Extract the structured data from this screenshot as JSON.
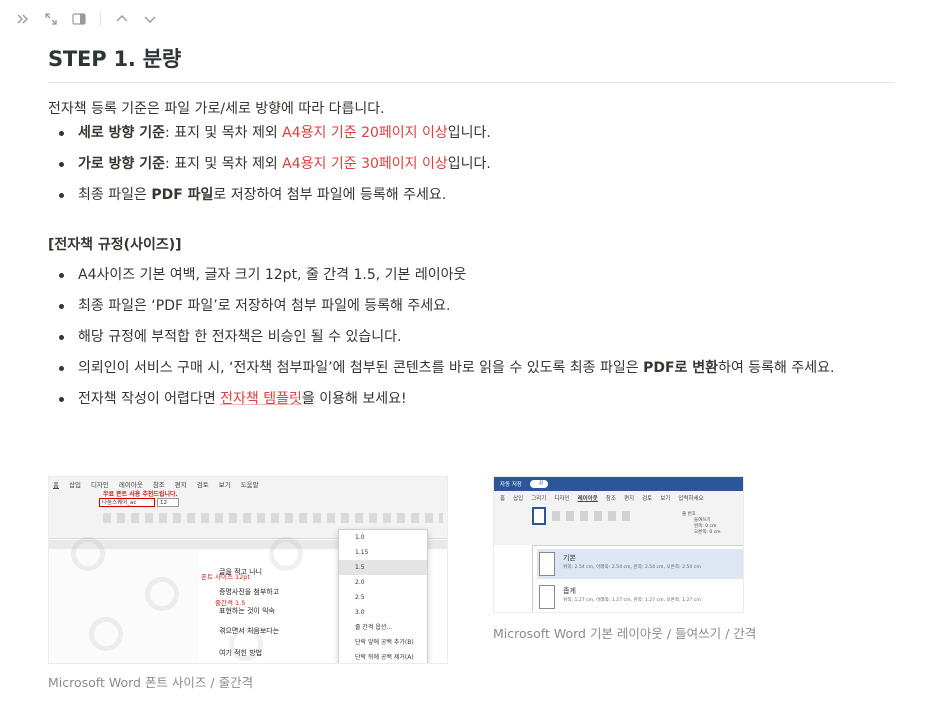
{
  "page": {
    "title": "STEP 1. 분량",
    "intro": "전자책 등록 기준은 파일 가로/세로 방향에 따라 다릅니다.",
    "bullets": [
      {
        "bold": "세로 방향 기준",
        "text": ": 표지 및 목차 제외 ",
        "red": "A4용지 기준 20페이지 이상",
        "tail": "입니다."
      },
      {
        "bold": "가로 방향 기준",
        "text": ": 표지 및 목차 제외 ",
        "red": "A4용지 기준 30페이지 이상",
        "tail": "입니다."
      },
      {
        "pre": "최종 파일은 ",
        "bold": "PDF 파일",
        "tail": "로 저장하여 첨부 파일에 등록해 주세요."
      }
    ],
    "section_heading": "[전자책 규정(사이즈)]",
    "rules": [
      {
        "text": "A4사이즈 기본 여백, 글자 크기 12pt, 줄 간격 1.5, 기본 레이아웃"
      },
      {
        "text": "최종 파일은 ‘PDF 파일’로 저장하여 첨부 파일에 등록해 주세요."
      },
      {
        "text": "해당 규정에 부적합 한 전자책은 비승인 될 수 있습니다."
      },
      {
        "pre": "의뢰인이 서비스 구매 시, ‘전자책 첨부파일’에 첨부된 콘텐츠를 바로 읽을 수 있도록 최종 파일은 ",
        "bold": "PDF로 변환",
        "tail": "하여 등록해 주세요."
      },
      {
        "pre": "전자책 작성이 어렵다면 ",
        "link": "전자책 템플릿",
        "hl": "을",
        "tail": " 이용해 보세요!"
      }
    ]
  },
  "toolbar": {
    "icons": [
      "double-chevron-right-icon",
      "expand-icon",
      "sidebar-panel-icon",
      "chevron-up-icon",
      "chevron-down-icon"
    ]
  },
  "figures": {
    "left_caption": "Microsoft Word 폰트 사이즈 / 줄간격",
    "right_caption": "Microsoft Word 기본 레이아웃 / 들여쓰기 / 간격",
    "word1": {
      "tabs": [
        "홈",
        "삽입",
        "디자인",
        "레이아웃",
        "참조",
        "편지",
        "검토",
        "보기",
        "도움말"
      ],
      "notice": "무료 폰트 사용 추천드립니다.",
      "font_name": "나눔스퀘어_ac",
      "font_size": "12",
      "tag_size": "폰트 사이즈 12pt",
      "tag_spacing": "줄간격 1.5",
      "line_spacing_options": [
        "1.0",
        "1.15",
        "1.5",
        "2.0",
        "2.5",
        "3.0",
        "줄 간격 옵션...",
        "단락 앞에 공백 추가(B)",
        "단락 뒤에 공백 제거(A)"
      ],
      "doc_lines": [
        "글을 적고 나니",
        "증명사진을 첨부하고",
        "표현하는 것이 익숙",
        "겪으면서 처음보다는",
        "여기 적힌 방법"
      ]
    },
    "word2": {
      "autosave": "자동 저장",
      "toggle": "끔",
      "tabs": [
        "홈",
        "삽입",
        "그리기",
        "디자인",
        "레이아웃",
        "참조",
        "편지",
        "검토",
        "보기",
        "입력하세요"
      ],
      "option1_name": "기본",
      "option1_desc": "위쪽: 2.54 cm, 아래쪽: 2.54 cm, 왼쪽: 2.54 cm, 오른쪽: 2.54 cm",
      "option2_name": "좁게",
      "option2_desc": "위쪽: 1.27 cm, 아래쪽: 1.27 cm, 왼쪽: 1.27 cm, 오른쪽: 1.27 cm",
      "indent_label": "들여쓰기",
      "spacing_label": "간격",
      "left_label": "왼쪽:",
      "right_label": "오른쪽:",
      "before_label": "앞:",
      "after_label": "뒤:",
      "indent_left_val": "0 cm",
      "indent_right_val": "0 cm",
      "spacing_before_val": "0 줄",
      "spacing_after_val": "0 줄",
      "line_num_label": "줄 번호"
    }
  }
}
